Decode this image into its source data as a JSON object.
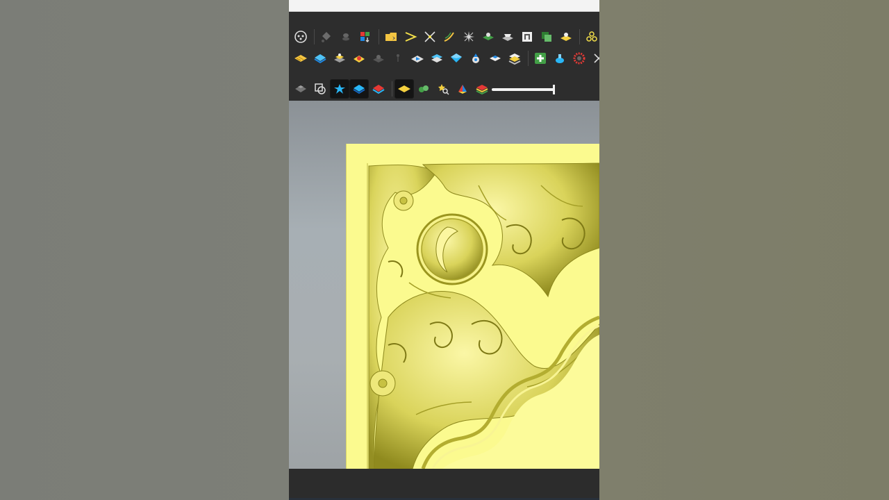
{
  "window": {
    "title": ""
  },
  "toolbar": {
    "rows": [
      [
        "view-cube-icon",
        "diamond-eraser-icon",
        "eye-dropper-icon",
        "color-grid-icon",
        "open-folder-icon",
        "vector-arrow-icon",
        "transform-arrows-icon",
        "curve-path-icon",
        "star-burst-icon",
        "green-relief-icon",
        "grey-relief-icon",
        "frame-icon",
        "green-layers-icon",
        "yellow-relief-icon",
        "nodes-icon"
      ],
      [
        "wood-texture-icon",
        "blue-layer-icon",
        "stack-relief-icon",
        "yellow-dome-icon",
        "grey-dome-icon",
        "pin-icon",
        "blue-plane-icon",
        "blue-sheet-icon",
        "blue-cube-icon",
        "blue-drop-icon",
        "blue-block-icon",
        "multi-layer-icon",
        "green-plus-icon",
        "blue-jar-icon",
        "red-gear-icon",
        "scissor-icon"
      ],
      [
        "grey-cube-icon",
        "copy-shape-icon",
        "blue-star-icon",
        "blue-layer-active-icon",
        "red-layer-icon",
        "yellow-plane-icon",
        "green-cluster-icon",
        "star-search-icon",
        "color-prism-icon",
        "rainbow-layer-icon"
      ]
    ],
    "slider": {
      "value": 1.0
    }
  },
  "colors": {
    "toolbar_bg": "#2d2d2d",
    "relief_yellow": "#fbfa8f",
    "relief_shadow": "#c9c34a",
    "viewport_top": "#8b9196",
    "viewport_bottom": "#9ea3a6"
  }
}
